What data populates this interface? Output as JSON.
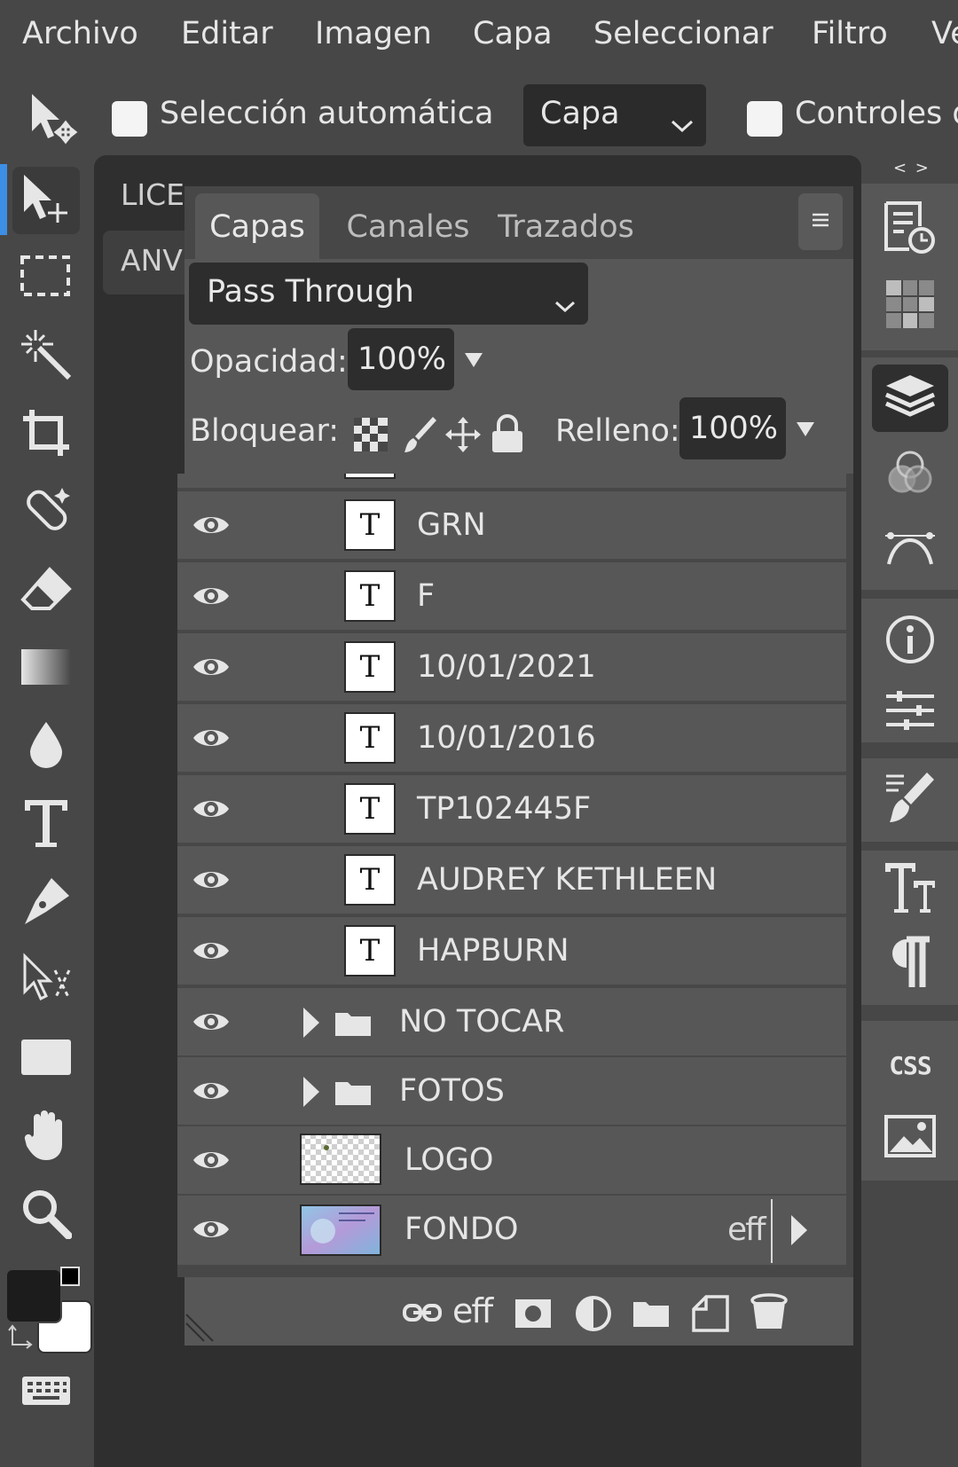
{
  "menu": [
    "Archivo",
    "Editar",
    "Imagen",
    "Capa",
    "Seleccionar",
    "Filtro",
    "Ve"
  ],
  "options": {
    "auto_select_label": "Selección automática",
    "auto_select_target": "Capa",
    "controls_label": "Controles d"
  },
  "documents": [
    "LICE",
    "ANV"
  ],
  "panel": {
    "tabs": [
      "Capas",
      "Canales",
      "Trazados"
    ],
    "blend_mode": "Pass Through",
    "opacity_label": "Opacidad:",
    "opacity_value": "100%",
    "lock_label": "Bloquear:",
    "fill_label": "Relleno:",
    "fill_value": "100%",
    "layers": [
      {
        "name": "GRN",
        "kind": "text",
        "thumb": "T"
      },
      {
        "name": "F",
        "kind": "text",
        "thumb": "T"
      },
      {
        "name": "10/01/2021",
        "kind": "text",
        "thumb": "T"
      },
      {
        "name": "10/01/2016",
        "kind": "text",
        "thumb": "T"
      },
      {
        "name": "TP102445F",
        "kind": "text",
        "thumb": "T"
      },
      {
        "name": "AUDREY KETHLEEN",
        "kind": "text",
        "thumb": "T"
      },
      {
        "name": "HAPBURN",
        "kind": "text",
        "thumb": "T"
      },
      {
        "name": "NO TOCAR",
        "kind": "group"
      },
      {
        "name": "FOTOS",
        "kind": "group"
      },
      {
        "name": "LOGO",
        "kind": "image"
      },
      {
        "name": "FONDO",
        "kind": "image",
        "fx": "eff"
      }
    ],
    "footer_fx": "eff"
  },
  "dock": {
    "collapse_glyph": "< >",
    "css_label": "CSS"
  },
  "colors": {
    "accent": "#3d8ee6",
    "foreground": "#1c1c1c",
    "background": "#ffffff"
  }
}
